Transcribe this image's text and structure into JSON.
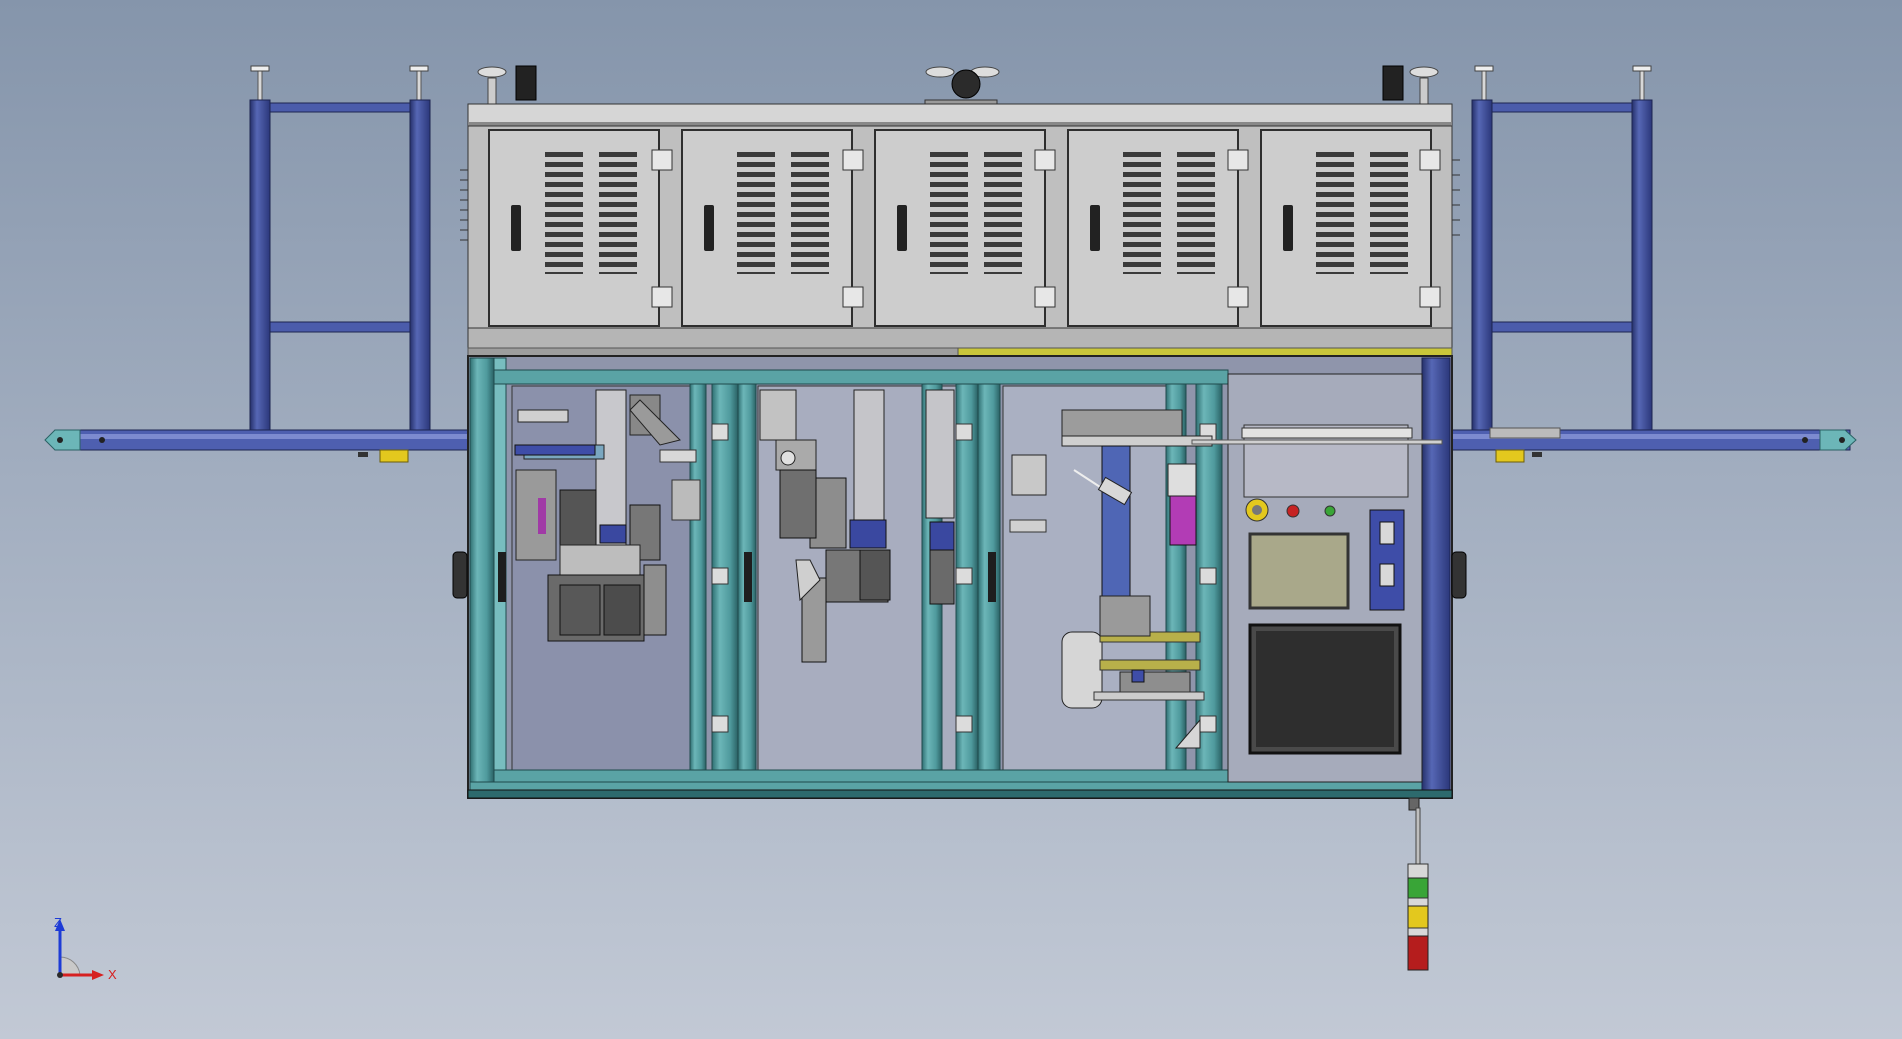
{
  "viewport": {
    "background_top": "#8595ab",
    "background_bottom": "#c2c9d5"
  },
  "colors": {
    "cabinet": "#c6c6c6",
    "frame_teal": "#5aa3a5",
    "frame_blue": "#42539a",
    "inner_panel": "#9aa0b6",
    "hmi_screen": "#2e2e2e",
    "label_plate": "#a9a88a",
    "tower_green": "#39a537",
    "tower_yellow": "#e3c81e",
    "tower_red": "#b51d1d"
  },
  "control_panel": {
    "label_line_1": "",
    "label_line_2": ""
  },
  "axes": {
    "z": "Z",
    "x": "X"
  }
}
